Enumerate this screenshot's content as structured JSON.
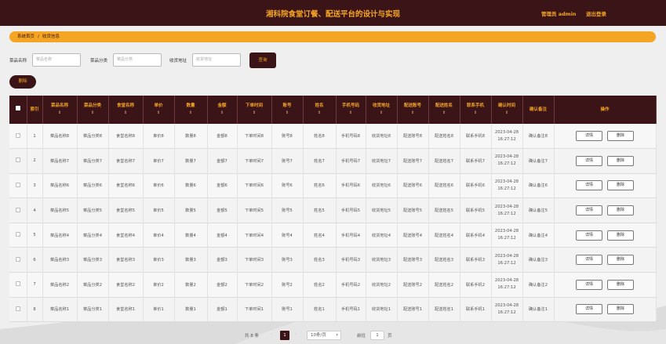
{
  "header": {
    "title": "湘科院食堂订餐、配送平台的设计与实现",
    "user": "管理员 admin",
    "logout": "退出登录"
  },
  "breadcrumb": {
    "home": "系统首页",
    "separator": "/",
    "current": "收货信息"
  },
  "search": {
    "dish_label": "菜品名称",
    "dish_placeholder": "菜品名称",
    "category_label": "菜品分类",
    "category_placeholder": "菜品分类",
    "address_label": "收货地址",
    "address_placeholder": "收货地址",
    "query": "查询"
  },
  "delete_label": "删除",
  "table": {
    "columns": [
      "索引",
      "菜品名称",
      "菜品分类",
      "食堂名称",
      "单价",
      "数量",
      "金额",
      "下单时间",
      "账号",
      "姓名",
      "手机号码",
      "收货地址",
      "配送账号",
      "配送姓名",
      "联系手机",
      "确认时间",
      "确认备注",
      "操作"
    ],
    "detail_label": "详情",
    "delete_label": "删除",
    "rows": [
      {
        "idx": "1",
        "dish": "菜品名称8",
        "cat": "菜品分类8",
        "canteen": "食堂名称8",
        "price": "单价8",
        "qty": "数量8",
        "amount": "金额8",
        "time": "下单时间8",
        "account": "账号8",
        "name": "姓名8",
        "phone": "手机号码8",
        "addr": "收货地址8",
        "daccount": "配送账号8",
        "dname": "配送姓名8",
        "dphone": "联系手机8",
        "ctime": "2023-04-28 16:27:12",
        "cnote": "确认备注8"
      },
      {
        "idx": "2",
        "dish": "菜品名称7",
        "cat": "菜品分类7",
        "canteen": "食堂名称7",
        "price": "单价7",
        "qty": "数量7",
        "amount": "金额7",
        "time": "下单时间7",
        "account": "账号7",
        "name": "姓名7",
        "phone": "手机号码7",
        "addr": "收货地址7",
        "daccount": "配送账号7",
        "dname": "配送姓名7",
        "dphone": "联系手机7",
        "ctime": "2023-04-28 16:27:12",
        "cnote": "确认备注7"
      },
      {
        "idx": "3",
        "dish": "菜品名称6",
        "cat": "菜品分类6",
        "canteen": "食堂名称6",
        "price": "单价6",
        "qty": "数量6",
        "amount": "金额6",
        "time": "下单时间6",
        "account": "账号6",
        "name": "姓名6",
        "phone": "手机号码6",
        "addr": "收货地址6",
        "daccount": "配送账号6",
        "dname": "配送姓名6",
        "dphone": "联系手机6",
        "ctime": "2023-04-28 16:27:12",
        "cnote": "确认备注6"
      },
      {
        "idx": "4",
        "dish": "菜品名称5",
        "cat": "菜品分类5",
        "canteen": "食堂名称5",
        "price": "单价5",
        "qty": "数量5",
        "amount": "金额5",
        "time": "下单时间5",
        "account": "账号5",
        "name": "姓名5",
        "phone": "手机号码5",
        "addr": "收货地址5",
        "daccount": "配送账号5",
        "dname": "配送姓名5",
        "dphone": "联系手机5",
        "ctime": "2023-04-28 16:27:12",
        "cnote": "确认备注5"
      },
      {
        "idx": "5",
        "dish": "菜品名称4",
        "cat": "菜品分类4",
        "canteen": "食堂名称4",
        "price": "单价4",
        "qty": "数量4",
        "amount": "金额4",
        "time": "下单时间4",
        "account": "账号4",
        "name": "姓名4",
        "phone": "手机号码4",
        "addr": "收货地址4",
        "daccount": "配送账号4",
        "dname": "配送姓名4",
        "dphone": "联系手机4",
        "ctime": "2023-04-28 16:27:12",
        "cnote": "确认备注4"
      },
      {
        "idx": "6",
        "dish": "菜品名称3",
        "cat": "菜品分类3",
        "canteen": "食堂名称3",
        "price": "单价3",
        "qty": "数量3",
        "amount": "金额3",
        "time": "下单时间3",
        "account": "账号3",
        "name": "姓名3",
        "phone": "手机号码3",
        "addr": "收货地址3",
        "daccount": "配送账号3",
        "dname": "配送姓名3",
        "dphone": "联系手机3",
        "ctime": "2023-04-28 16:27:12",
        "cnote": "确认备注3"
      },
      {
        "idx": "7",
        "dish": "菜品名称2",
        "cat": "菜品分类2",
        "canteen": "食堂名称2",
        "price": "单价2",
        "qty": "数量2",
        "amount": "金额2",
        "time": "下单时间2",
        "account": "账号2",
        "name": "姓名2",
        "phone": "手机号码2",
        "addr": "收货地址2",
        "daccount": "配送账号2",
        "dname": "配送姓名2",
        "dphone": "联系手机2",
        "ctime": "2023-04-28 16:27:12",
        "cnote": "确认备注2"
      },
      {
        "idx": "8",
        "dish": "菜品名称1",
        "cat": "菜品分类1",
        "canteen": "食堂名称1",
        "price": "单价1",
        "qty": "数量1",
        "amount": "金额1",
        "time": "下单时间1",
        "account": "账号1",
        "name": "姓名1",
        "phone": "手机号码1",
        "addr": "收货地址1",
        "daccount": "配送账号1",
        "dname": "配送姓名1",
        "dphone": "联系手机1",
        "ctime": "2023-04-28 16:27:12",
        "cnote": "确认备注1"
      }
    ]
  },
  "pager": {
    "total": "共 8 条",
    "prev": "‹",
    "page": "1",
    "next": "›",
    "size": "10条/页",
    "goto_label": "前往",
    "goto_value": "1",
    "goto_suffix": "页"
  },
  "colors": {
    "primary": "#3a1416",
    "accent": "#f5a524"
  }
}
